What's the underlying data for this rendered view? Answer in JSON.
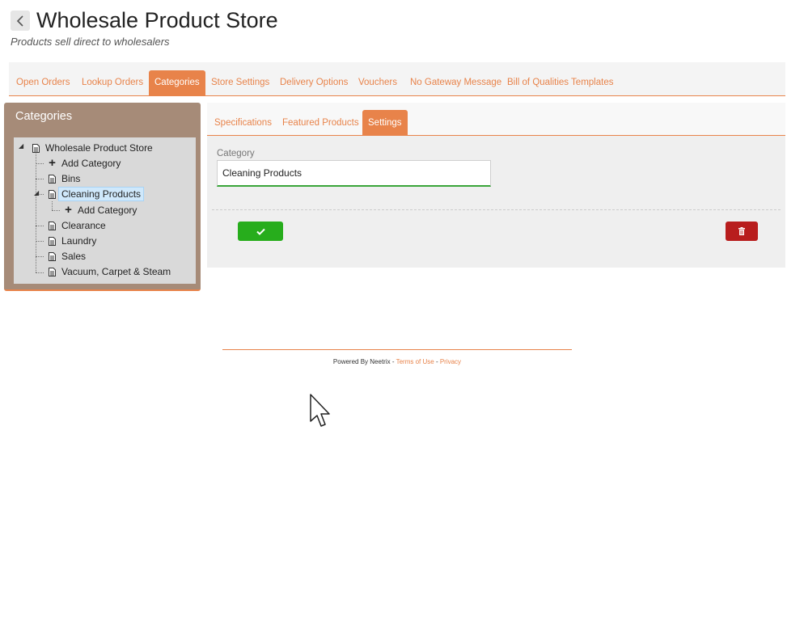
{
  "header": {
    "title": "Wholesale Product Store",
    "subtitle": "Products sell direct to wholesalers",
    "back_icon": "chevron-left-icon"
  },
  "main_tabs": [
    {
      "label": "Open Orders",
      "active": false
    },
    {
      "label": "Lookup Orders",
      "active": false
    },
    {
      "label": "Categories",
      "active": true
    },
    {
      "label": "Store Settings",
      "active": false
    },
    {
      "label": "Delivery Options",
      "active": false
    },
    {
      "label": "Vouchers",
      "active": false
    },
    {
      "label": "No Gateway Message",
      "active": false
    },
    {
      "label": "Bill of Qualities Templates",
      "active": false
    }
  ],
  "categories_panel": {
    "title": "Categories",
    "tree": {
      "root": "Wholesale Product Store",
      "items": [
        {
          "label": "Add Category",
          "icon": "plus-icon"
        },
        {
          "label": "Bins",
          "icon": "document-icon"
        },
        {
          "label": "Cleaning Products",
          "icon": "document-icon",
          "selected": true,
          "expanded": true,
          "children": [
            {
              "label": "Add Category",
              "icon": "plus-icon"
            }
          ]
        },
        {
          "label": "Clearance",
          "icon": "document-icon"
        },
        {
          "label": "Laundry",
          "icon": "document-icon"
        },
        {
          "label": "Sales",
          "icon": "document-icon"
        },
        {
          "label": "Vacuum, Carpet & Steam",
          "icon": "document-icon"
        }
      ]
    }
  },
  "sub_tabs": [
    {
      "label": "Specifications",
      "active": false
    },
    {
      "label": "Featured Products",
      "active": false
    },
    {
      "label": "Settings",
      "active": true
    }
  ],
  "settings": {
    "category_label": "Category",
    "category_value": "Cleaning Products",
    "save_icon": "check-icon",
    "delete_icon": "trash-icon"
  },
  "footer": {
    "powered_by": "Powered By Neetrix - ",
    "terms": "Terms of Use",
    "separator": " - ",
    "privacy": "Privacy"
  },
  "colors": {
    "accent": "#e8834a",
    "panel": "#a68b78",
    "save": "#27ad1c",
    "delete": "#b81d1d"
  }
}
